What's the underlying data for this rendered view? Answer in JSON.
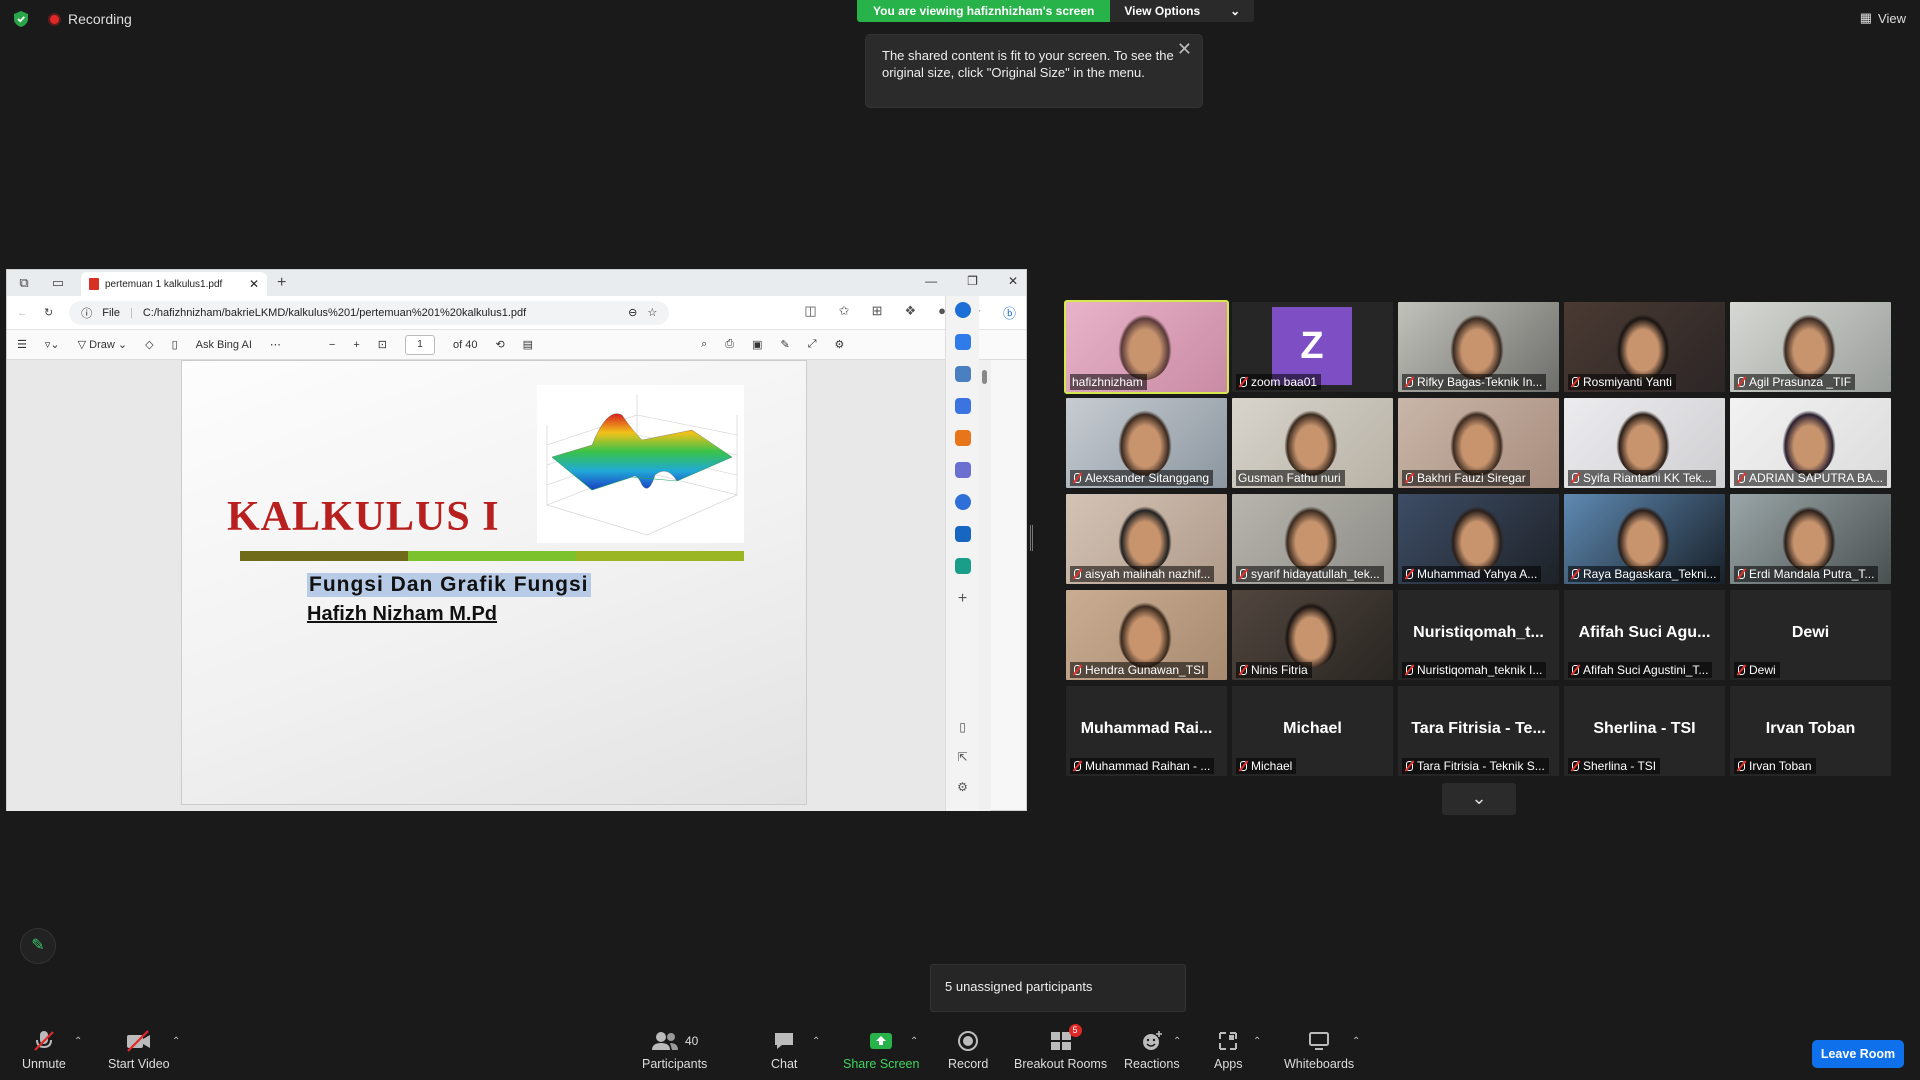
{
  "top": {
    "recording": "Recording",
    "banner_viewing": "You are viewing hafiznhizham's screen",
    "view_options": "View Options",
    "view": "View",
    "tip": "The shared content is fit to your screen. To see the original size, click \"Original Size\" in the menu."
  },
  "browser": {
    "tab_title": "pertemuan 1 kalkulus1.pdf",
    "file_label": "File",
    "url": "C:/hafizhnizham/bakrieLKMD/kalkulus%201/pertemuan%201%20kalkulus1.pdf",
    "draw": "Draw",
    "ask_bing": "Ask Bing AI",
    "page": "1",
    "page_of": "of 40"
  },
  "slide": {
    "title": "KALKULUS I",
    "subtitle": "Fungsi  Dan  Grafik Fungsi",
    "author": "Hafizh Nizham M.Pd"
  },
  "gallery": [
    {
      "name": "hafizhnizham",
      "muted": false,
      "type": "video",
      "active": true
    },
    {
      "name": "zoom baa01",
      "muted": true,
      "type": "avatar",
      "letter": "Z"
    },
    {
      "name": "Rifky Bagas-Teknik In...",
      "muted": true,
      "type": "video"
    },
    {
      "name": "Rosmiyanti Yanti",
      "muted": true,
      "type": "video"
    },
    {
      "name": "Agil Prasunza _TIF",
      "muted": true,
      "type": "video"
    },
    {
      "name": "Alexsander Sitanggang",
      "muted": true,
      "type": "video"
    },
    {
      "name": "Gusman Fathu nuri",
      "muted": false,
      "type": "video"
    },
    {
      "name": "Bakhri Fauzi Siregar",
      "muted": true,
      "type": "video"
    },
    {
      "name": "Syifa Riantami KK Tek...",
      "muted": true,
      "type": "video"
    },
    {
      "name": "ADRIAN SAPUTRA BA...",
      "muted": true,
      "type": "video"
    },
    {
      "name": "aisyah malihah nazhif...",
      "muted": true,
      "type": "video"
    },
    {
      "name": "syarif hidayatullah_tek...",
      "muted": true,
      "type": "video"
    },
    {
      "name": "Muhammad Yahya A...",
      "muted": true,
      "type": "video"
    },
    {
      "name": "Raya Bagaskara_Tekni...",
      "muted": true,
      "type": "video"
    },
    {
      "name": "Erdi Mandala Putra_T...",
      "muted": true,
      "type": "video"
    },
    {
      "name": "Hendra Gunawan_TSI",
      "muted": true,
      "type": "video"
    },
    {
      "name": "Ninis Fitria",
      "muted": true,
      "type": "video"
    },
    {
      "name": "Nuristiqomah_teknik I...",
      "muted": true,
      "type": "text",
      "big": "Nuristiqomah_t..."
    },
    {
      "name": "Afifah Suci Agustini_T...",
      "muted": true,
      "type": "text",
      "big": "Afifah Suci Agu..."
    },
    {
      "name": "Dewi",
      "muted": true,
      "type": "text",
      "big": "Dewi"
    },
    {
      "name": "Muhammad Raihan - ...",
      "muted": true,
      "type": "text",
      "big": "Muhammad  Rai..."
    },
    {
      "name": "Michael",
      "muted": true,
      "type": "text",
      "big": "Michael"
    },
    {
      "name": "Tara Fitrisia - Teknik S...",
      "muted": true,
      "type": "text",
      "big": "Tara Fitrisia - Te..."
    },
    {
      "name": "Sherlina - TSI",
      "muted": true,
      "type": "text",
      "big": "Sherlina - TSI"
    },
    {
      "name": "Irvan Toban",
      "muted": true,
      "type": "text",
      "big": "Irvan Toban"
    }
  ],
  "unassigned": "5 unassigned participants",
  "toolbar": {
    "unmute": "Unmute",
    "start_video": "Start Video",
    "participants": "Participants",
    "participants_count": "40",
    "chat": "Chat",
    "share_screen": "Share Screen",
    "record": "Record",
    "breakout": "Breakout Rooms",
    "breakout_badge": "5",
    "reactions": "Reactions",
    "apps": "Apps",
    "whiteboards": "Whiteboards",
    "leave": "Leave Room"
  }
}
